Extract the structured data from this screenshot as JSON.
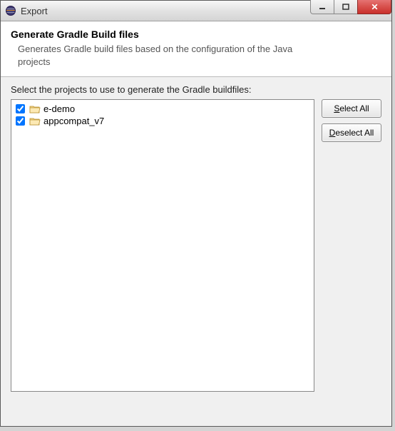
{
  "window": {
    "title": "Export"
  },
  "banner": {
    "heading": "Generate Gradle Build files",
    "description": "Generates Gradle build files based on the configuration of the Java projects"
  },
  "content": {
    "instruction": "Select the projects to use to generate the Gradle buildfiles:"
  },
  "projects": [
    {
      "label": "e-demo",
      "checked": true
    },
    {
      "label": "appcompat_v7",
      "checked": true
    }
  ],
  "buttons": {
    "select_all_pre": "",
    "select_all_mn": "S",
    "select_all_post": "elect All",
    "deselect_all_pre": "",
    "deselect_all_mn": "D",
    "deselect_all_post": "eselect All"
  }
}
